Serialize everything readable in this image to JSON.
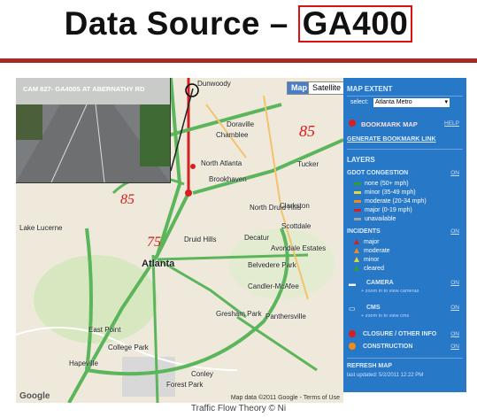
{
  "slide": {
    "title_prefix": "Data Source – ",
    "title_highlight": "GA400",
    "footer": "Traffic Flow Theory © Ni"
  },
  "map": {
    "buttons": [
      "Map",
      "Satellite"
    ],
    "camera_caption": "CAM 827- GA400S AT ABERNATHY RD",
    "towns": [
      "Dunwoody",
      "Doraville",
      "Chamblee",
      "North Atlanta",
      "Tucker",
      "Brookhaven",
      "North Druid Hills",
      "Clarkston",
      "Druid Hills",
      "Decatur",
      "Scottdale",
      "Atlanta",
      "Belvedere Park",
      "Candler-McAfee",
      "Panthersville",
      "Gresham Park",
      "East Point",
      "College Park",
      "Hapeville",
      "Forest Park",
      "Conley",
      "Lake Lucerne",
      "Avondale Estates"
    ],
    "handwriting": {
      "85_top": "85",
      "85_left": "85",
      "75": "75"
    },
    "copyright": "Map data ©2011 Google - Terms of Use",
    "google_logo": "Google"
  },
  "panel": {
    "map_extent_header": "MAP EXTENT",
    "select_label": "select:",
    "select_value": "Atlanta Metro",
    "bookmark_map": "BOOKMARK MAP",
    "help": "HELP",
    "generate_bookmark": "GENERATE BOOKMARK LINK",
    "layers_header": "LAYERS",
    "gdot_header": "GDOT CONGESTION",
    "on": "ON",
    "congestion": [
      {
        "label": "none (50+ mph)",
        "color": "#2e9e2e"
      },
      {
        "label": "minor (35-49 mph)",
        "color": "#e6d43a"
      },
      {
        "label": "moderate (20-34 mph)",
        "color": "#f08a1c"
      },
      {
        "label": "major (0-19 mph)",
        "color": "#d62020"
      },
      {
        "label": "unavailable",
        "color": "#9aa2aa"
      }
    ],
    "incidents_header": "INCIDENTS",
    "incidents": [
      {
        "label": "major",
        "color": "#d62020"
      },
      {
        "label": "moderate",
        "color": "#f08a1c"
      },
      {
        "label": "minor",
        "color": "#e6d43a"
      },
      {
        "label": "cleared",
        "color": "#2e9e2e"
      }
    ],
    "camera_header": "CAMERA",
    "camera_zoom": "+ zoom in to view cameras",
    "cms_header": "CMS",
    "cms_zoom": "+ zoom in to view cms",
    "closure": "CLOSURE / OTHER INFO",
    "construction": "CONSTRUCTION",
    "refresh_map": "REFRESH MAP",
    "last_updated": "last updated: 5/2/2011 12:22 PM"
  }
}
